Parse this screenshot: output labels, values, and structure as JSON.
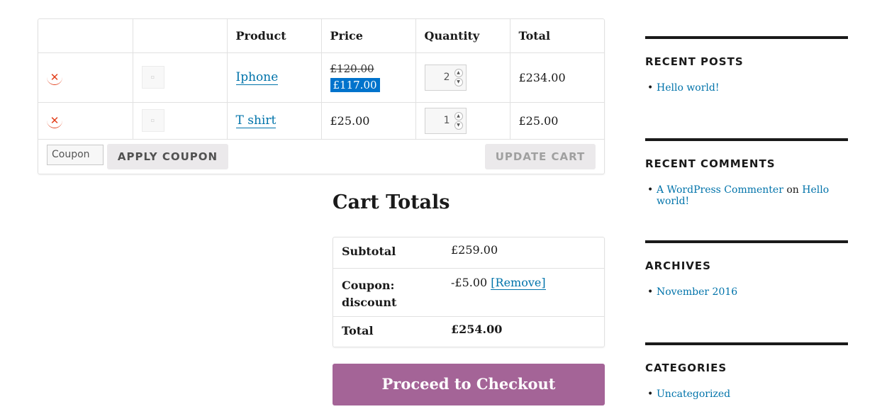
{
  "cart": {
    "headers": [
      "",
      "",
      "Product",
      "Price",
      "Quantity",
      "Total"
    ],
    "items": [
      {
        "name": "Iphone",
        "price_old": "£120.00",
        "price": "£117.00",
        "quantity": "2",
        "total": "£234.00"
      },
      {
        "name": "T shirt",
        "price": "£25.00",
        "quantity": "1",
        "total": "£25.00"
      }
    ],
    "coupon_placeholder": "Coupon",
    "apply_coupon": "Apply Coupon",
    "update_cart": "Update Cart"
  },
  "totals": {
    "title": "Cart Totals",
    "subtotal_label": "Subtotal",
    "subtotal_value": "£259.00",
    "coupon_label": "Coupon: discount",
    "coupon_value": "-£5.00",
    "coupon_remove": "[Remove]",
    "total_label": "Total",
    "total_value": "£254.00",
    "checkout": "Proceed to Checkout"
  },
  "sidebar": {
    "recent_posts": {
      "title": "Recent Posts",
      "items": [
        "Hello world!"
      ]
    },
    "recent_comments": {
      "title": "Recent Comments",
      "author": "A WordPress Commenter",
      "on": "on",
      "post": "Hello world!"
    },
    "archives": {
      "title": "Archives",
      "items": [
        "November 2016"
      ]
    },
    "categories": {
      "title": "Categories",
      "items": [
        "Uncategorized"
      ]
    }
  },
  "colors": {
    "link": "#0073aa",
    "checkout": "#a46497",
    "remove": "#e2401c",
    "sale_highlight": "#0073cc"
  }
}
